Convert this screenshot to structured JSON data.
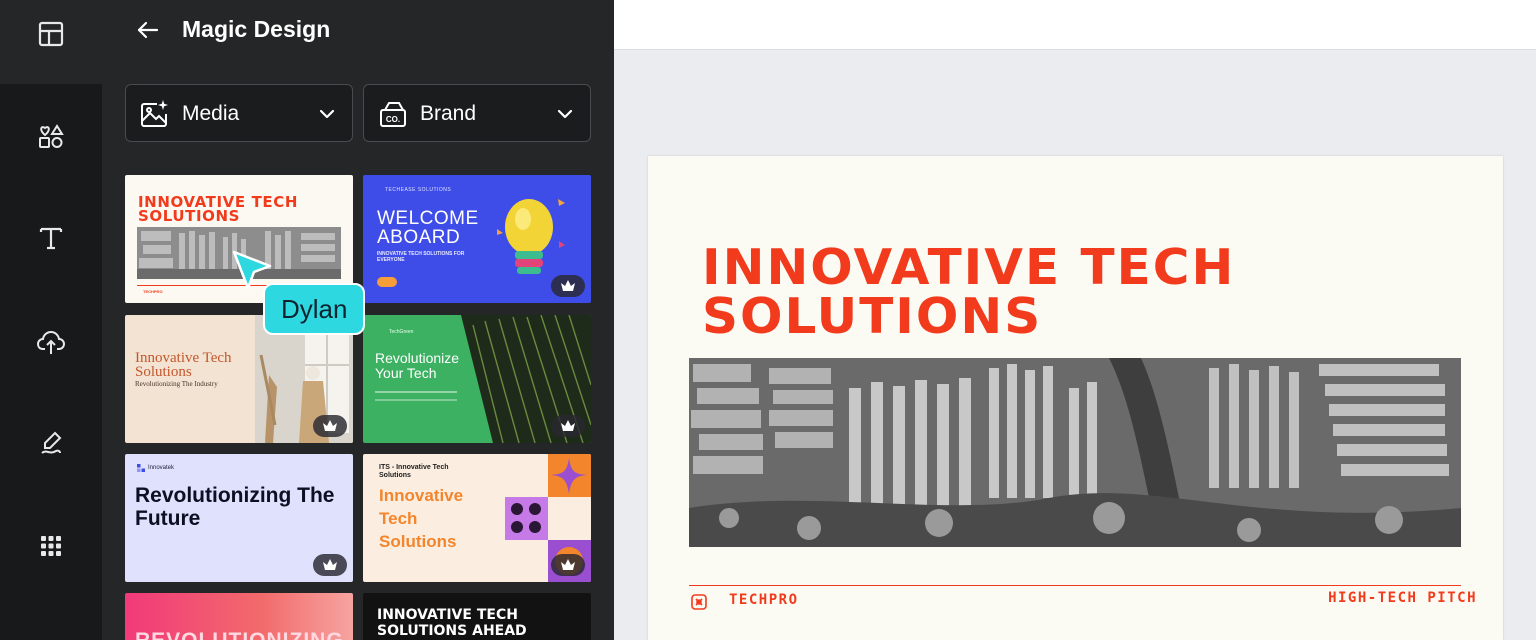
{
  "panel": {
    "title": "Magic Design",
    "filters": [
      {
        "label": "Media",
        "icon": "media-sparkle-icon"
      },
      {
        "label": "Brand",
        "icon": "brand-kit-icon"
      }
    ]
  },
  "templates": [
    {
      "name": "innovative-tech-red",
      "title": "INNOVATIVE TECH SOLUTIONS",
      "footer": "TECHPRO",
      "premium": false
    },
    {
      "name": "welcome-aboard",
      "brand": "TECHEASE SOLUTIONS",
      "title": "WELCOME ABOARD",
      "subtitle": "INNOVATIVE TECH SOLUTIONS FOR EVERYONE",
      "premium": true
    },
    {
      "name": "innovative-beige",
      "title": "Innovative Tech Solutions",
      "subtitle": "Revolutionizing The Industry",
      "premium": true
    },
    {
      "name": "revolutionize-green",
      "brand": "TechGreen",
      "title": "Revolutionize Your Tech",
      "premium": true
    },
    {
      "name": "revolutionizing-lavender",
      "brand": "Innovatek",
      "title": "Revolutionizing The Future",
      "premium": true
    },
    {
      "name": "its-orange",
      "brand": "ITS - Innovative Tech Solutions",
      "title": "Innovative Tech Solutions",
      "premium": true
    },
    {
      "name": "revolutionizing-pink",
      "title": "REVOLUTIONIZING",
      "premium": false
    },
    {
      "name": "innovative-dark",
      "title": "INNOVATIVE TECH SOLUTIONS AHEAD",
      "premium": false
    }
  ],
  "cursor": {
    "user": "Dylan",
    "color": "#2ed8e0"
  },
  "slide": {
    "title": "INNOVATIVE TECH SOLUTIONS",
    "brand": "TECHPRO",
    "tag": "HIGH-TECH PITCH",
    "accent": "#f23a1d"
  },
  "colors": {
    "panel_bg": "#252627",
    "rail_bg": "#18191b",
    "canvas_bg": "#ebecf0"
  }
}
